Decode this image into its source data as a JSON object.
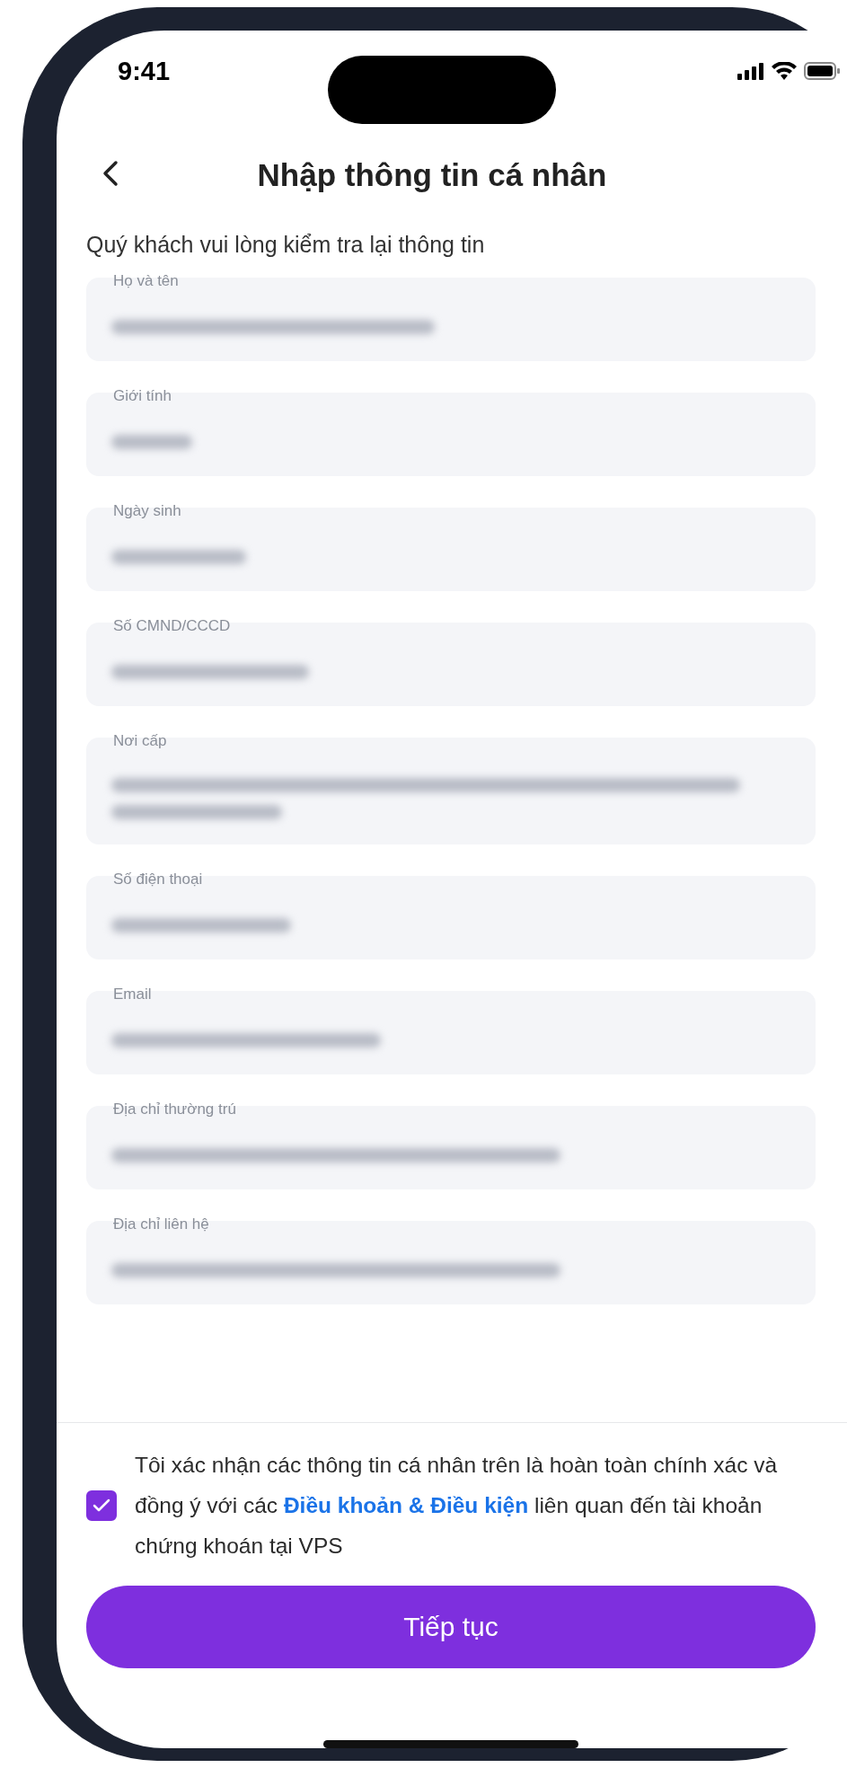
{
  "status_bar": {
    "time": "9:41"
  },
  "header": {
    "title": "Nhập thông tin cá nhân"
  },
  "subtitle": "Quý khách vui lòng kiểm tra lại thông tin",
  "fields": [
    {
      "label": "Họ và tên",
      "kind": "one-line"
    },
    {
      "label": "Giới tính",
      "kind": "one-line"
    },
    {
      "label": "Ngày sinh",
      "kind": "one-line"
    },
    {
      "label": "Số CMND/CCCD",
      "kind": "one-line"
    },
    {
      "label": "Nơi cấp",
      "kind": "two-line"
    },
    {
      "label": "Số điện thoại",
      "kind": "one-line"
    },
    {
      "label": "Email",
      "kind": "one-line"
    },
    {
      "label": "Địa chỉ thường trú",
      "kind": "one-line"
    },
    {
      "label": "Địa chỉ liên hệ",
      "kind": "one-line"
    }
  ],
  "consent": {
    "checked": true,
    "text_before": "Tôi xác nhận các thông tin cá nhân trên là hoàn toàn chính xác và đồng ý với các",
    "link": "Điều khoản & Điều kiện",
    "text_after": "liên quan đến tài khoản chứng khoán tại VPS"
  },
  "continue_button": "Tiếp tục"
}
